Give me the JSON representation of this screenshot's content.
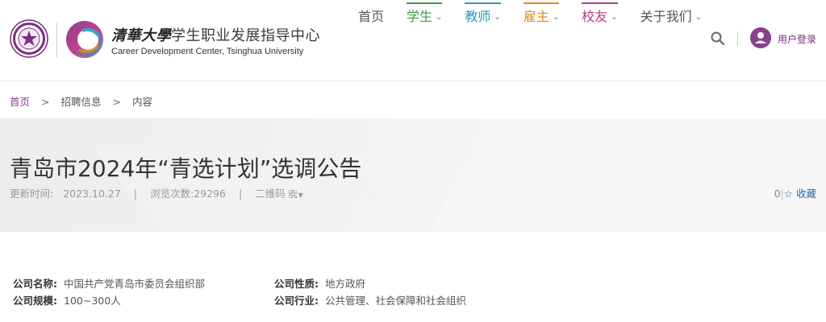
{
  "header": {
    "brand_cn_calligraphy": "清華大學",
    "brand_cn_rest": "学生职业发展指导中心",
    "brand_en": "Career Development Center, Tsinghua University",
    "login_label": "用户登录"
  },
  "nav": {
    "home": "首页",
    "students": "学生",
    "teachers": "教师",
    "employers": "雇主",
    "alumni": "校友",
    "about": "关于我们",
    "colors": {
      "students": "#3a9a4c",
      "teachers": "#2c98b8",
      "employers": "#e08a14",
      "alumni": "#b43a8a"
    }
  },
  "breadcrumb": {
    "home": "首页",
    "recruitment": "招聘信息",
    "current": "内容",
    "sep": ">"
  },
  "article": {
    "title": "青岛市2024年“青选计划”选调公告",
    "updated_label": "更新时间:",
    "updated_value": "2023.10.27",
    "views_label": "浏览次数:",
    "views_value": "29296",
    "qr_label": "二维码",
    "fav_count": "0",
    "fav_label": "收藏"
  },
  "company": {
    "name_label": "公司名称:",
    "name_value": "中国共产党青岛市委员会组织部",
    "nature_label": "公司性质:",
    "nature_value": "地方政府",
    "scale_label": "公司规模:",
    "scale_value": "100~300人",
    "industry_label": "公司行业:",
    "industry_value": "公共管理、社会保障和社会组织"
  },
  "colors": {
    "brand_purple": "#8a3f8f"
  }
}
